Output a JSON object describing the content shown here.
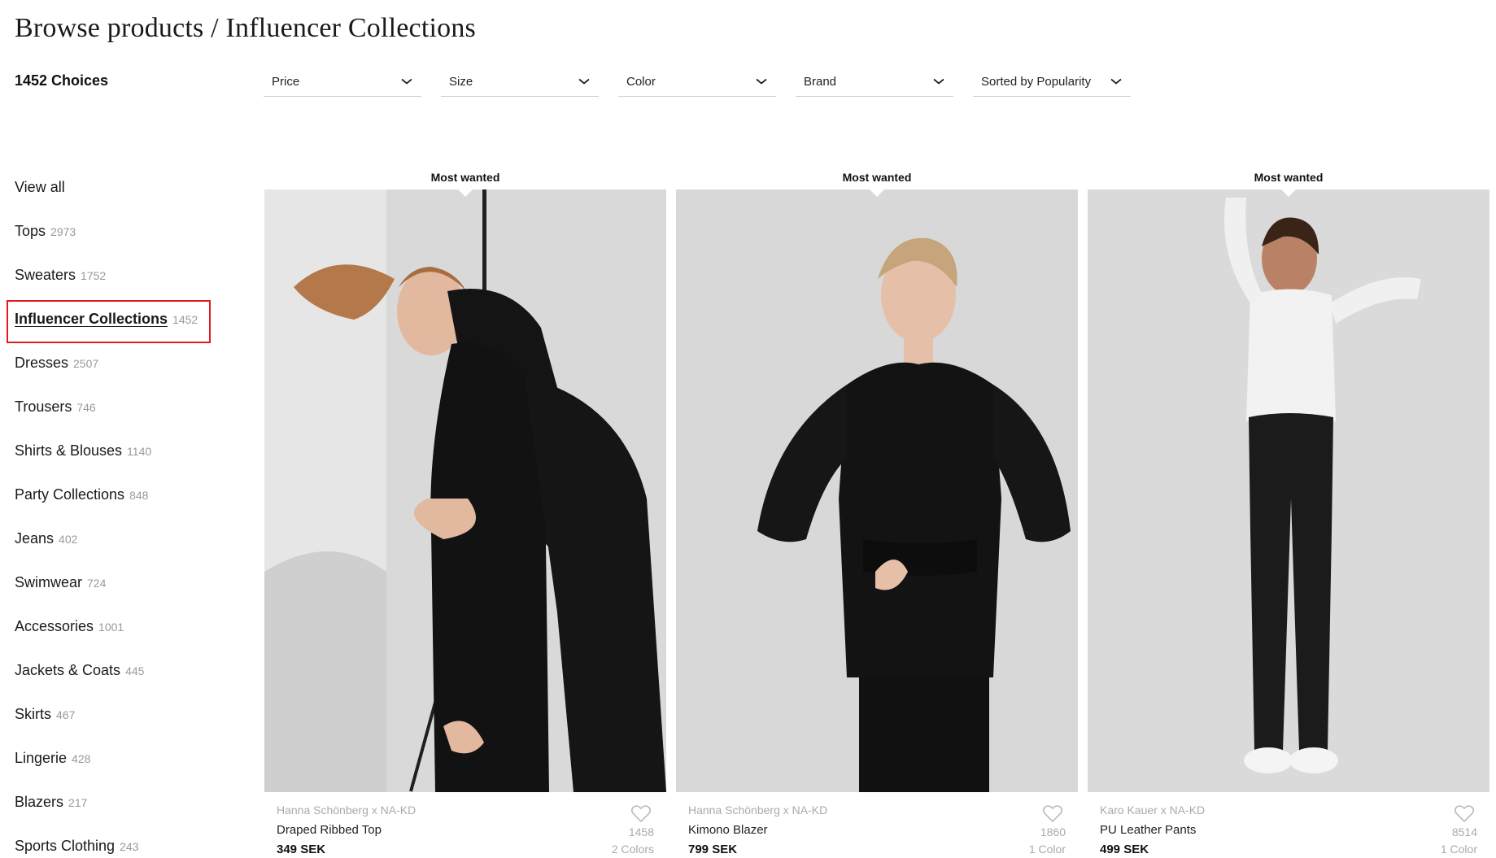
{
  "header": {
    "breadcrumb": "Browse products / Influencer Collections",
    "choices": "1452 Choices"
  },
  "filters": [
    {
      "label": "Price",
      "icon": "chevron-down-icon"
    },
    {
      "label": "Size",
      "icon": "chevron-down-icon"
    },
    {
      "label": "Color",
      "icon": "chevron-down-icon"
    },
    {
      "label": "Brand",
      "icon": "chevron-down-icon"
    },
    {
      "label": "Sorted by Popularity",
      "icon": "chevron-down-icon"
    }
  ],
  "sidebar": {
    "items": [
      {
        "name": "View all",
        "count": ""
      },
      {
        "name": "Tops",
        "count": "2973"
      },
      {
        "name": "Sweaters",
        "count": "1752"
      },
      {
        "name": "Influencer Collections",
        "count": "1452",
        "active": true
      },
      {
        "name": "Dresses",
        "count": "2507"
      },
      {
        "name": "Trousers",
        "count": "746"
      },
      {
        "name": "Shirts & Blouses",
        "count": "1140"
      },
      {
        "name": "Party Collections",
        "count": "848"
      },
      {
        "name": "Jeans",
        "count": "402"
      },
      {
        "name": "Swimwear",
        "count": "724"
      },
      {
        "name": "Accessories",
        "count": "1001"
      },
      {
        "name": "Jackets & Coats",
        "count": "445"
      },
      {
        "name": "Skirts",
        "count": "467"
      },
      {
        "name": "Lingerie",
        "count": "428"
      },
      {
        "name": "Blazers",
        "count": "217"
      },
      {
        "name": "Sports Clothing",
        "count": "243"
      }
    ]
  },
  "products": [
    {
      "badge": "Most wanted",
      "brand": "Hanna Schönberg x NA-KD",
      "name": "Draped Ribbed Top",
      "price": "349 SEK",
      "likes": "1458",
      "colors": "2 Colors",
      "photo": "model in black ribbed top and trousers"
    },
    {
      "badge": "Most wanted",
      "brand": "Hanna Schönberg x NA-KD",
      "name": "Kimono Blazer",
      "price": "799 SEK",
      "likes": "1860",
      "colors": "1 Color",
      "photo": "model in black kimono blazer"
    },
    {
      "badge": "Most wanted",
      "brand": "Karo Kauer x NA-KD",
      "name": "PU Leather Pants",
      "price": "499 SEK",
      "likes": "8514",
      "colors": "1 Color",
      "photo": "model in white top and black leather pants"
    }
  ],
  "colors": {
    "active_highlight": "#e01b24",
    "photo_bg": "#d6d6d6",
    "muted_text": "#999999"
  }
}
